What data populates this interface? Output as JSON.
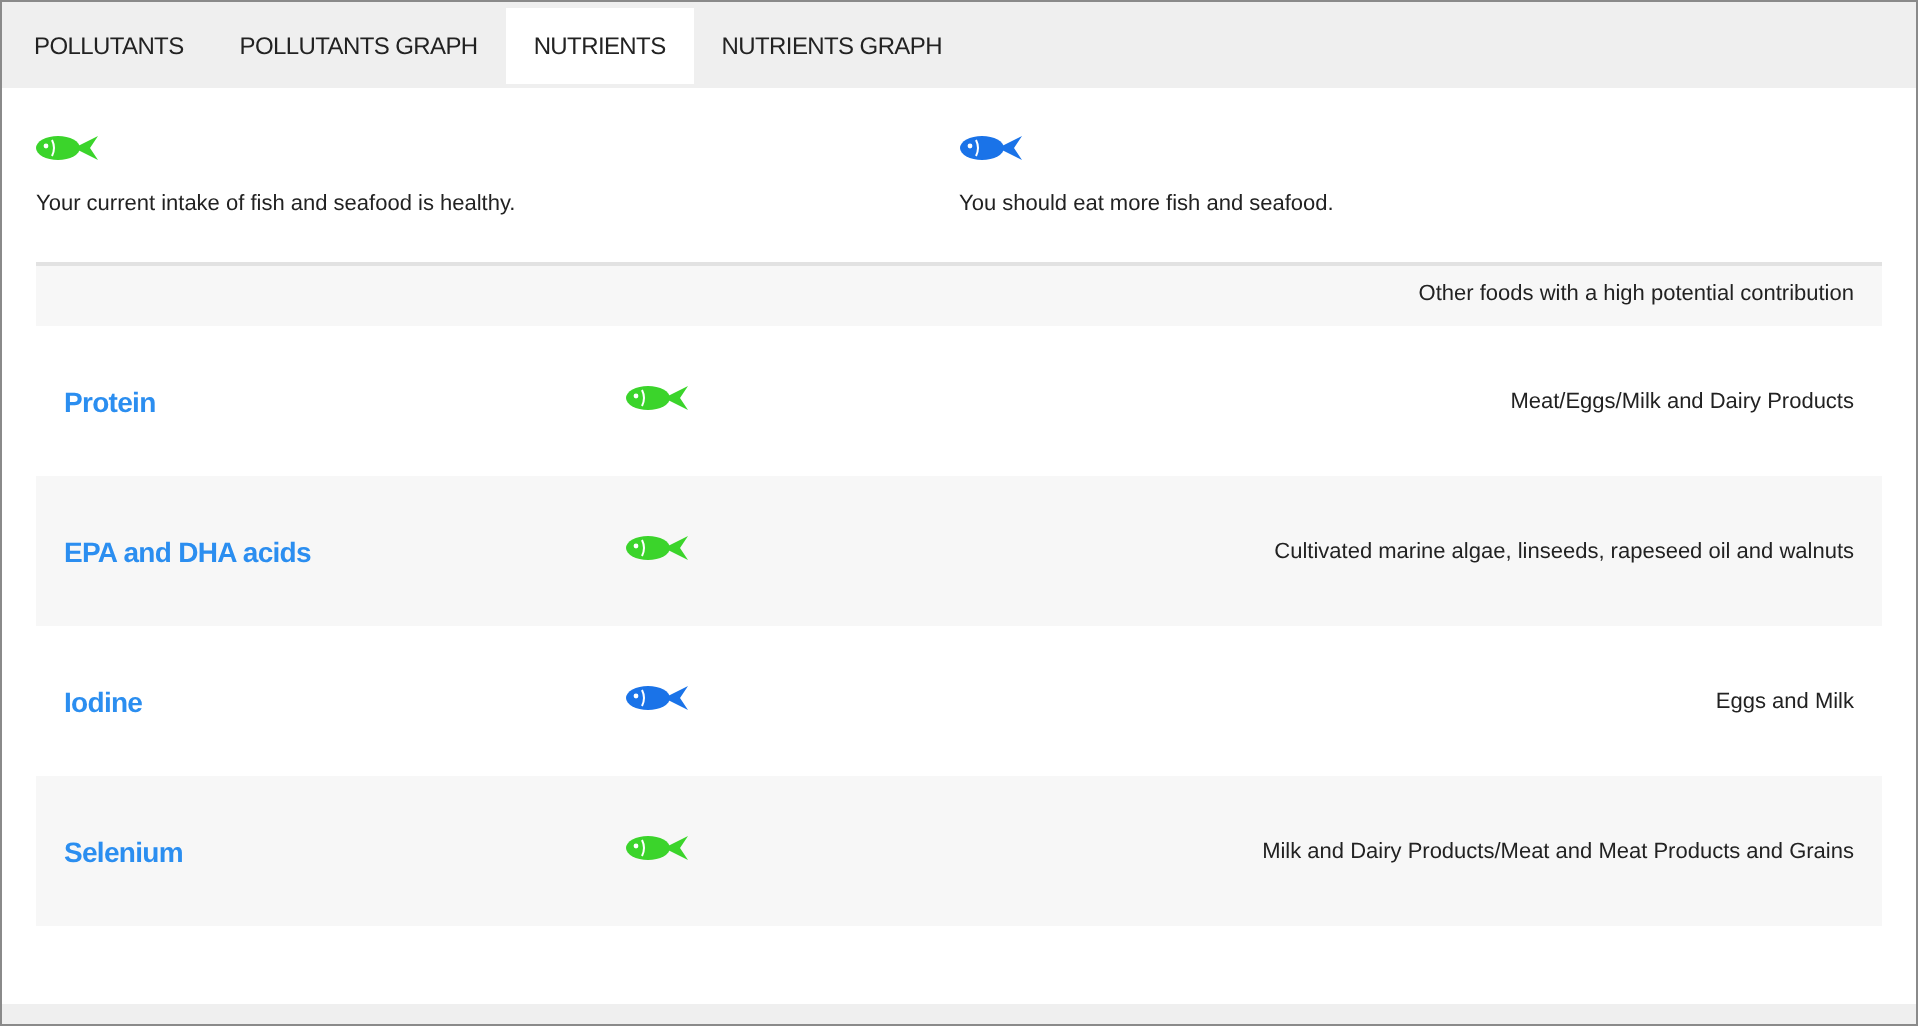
{
  "tabs": [
    {
      "label": "POLLUTANTS",
      "selected": false
    },
    {
      "label": "POLLUTANTS GRAPH",
      "selected": false
    },
    {
      "label": "NUTRIENTS",
      "selected": true
    },
    {
      "label": "NUTRIENTS GRAPH",
      "selected": false
    }
  ],
  "legend": [
    {
      "color": "#3bd42b",
      "text": "Your current intake of fish and seafood is healthy."
    },
    {
      "color": "#1a73e8",
      "text": "You should eat more fish and seafood."
    }
  ],
  "table": {
    "header": "Other foods with a high potential contribution",
    "rows": [
      {
        "nutrient": "Protein",
        "color": "#3bd42b",
        "other_foods": "Meat/Eggs/Milk and Dairy Products"
      },
      {
        "nutrient": "EPA and DHA acids",
        "color": "#3bd42b",
        "other_foods": "Cultivated marine algae, linseeds, rapeseed oil and walnuts"
      },
      {
        "nutrient": "Iodine",
        "color": "#1a73e8",
        "other_foods": "Eggs and Milk"
      },
      {
        "nutrient": "Selenium",
        "color": "#3bd42b",
        "other_foods": "Milk and Dairy Products/Meat and Meat Products and Grains"
      }
    ]
  }
}
